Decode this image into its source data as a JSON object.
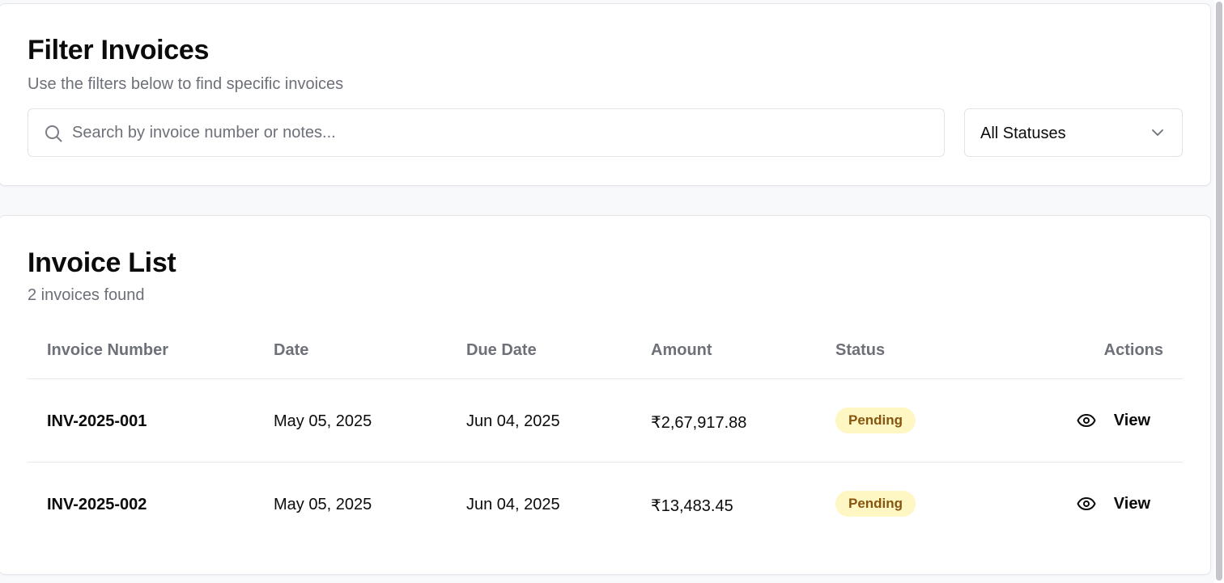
{
  "filter": {
    "title": "Filter Invoices",
    "subtitle": "Use the filters below to find specific invoices",
    "search_placeholder": "Search by invoice number or notes...",
    "search_value": "",
    "status_selected": "All Statuses"
  },
  "invoices": {
    "title": "Invoice List",
    "count_text": "2 invoices found",
    "columns": [
      "Invoice Number",
      "Date",
      "Due Date",
      "Amount",
      "Status",
      "Actions"
    ],
    "rows": [
      {
        "number": "INV-2025-001",
        "date": "May 05, 2025",
        "due": "Jun 04, 2025",
        "amount": "₹2,67,917.88",
        "status": "Pending",
        "action": "View"
      },
      {
        "number": "INV-2025-002",
        "date": "May 05, 2025",
        "due": "Jun 04, 2025",
        "amount": "₹13,483.45",
        "status": "Pending",
        "action": "View"
      }
    ]
  },
  "colors": {
    "pending_bg": "#fef6c3",
    "pending_text": "#86550f",
    "muted_text": "#6d7079"
  },
  "icons": [
    "search-icon",
    "chevron-down-icon",
    "eye-icon"
  ]
}
